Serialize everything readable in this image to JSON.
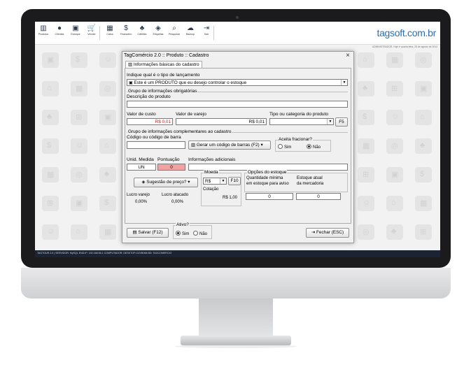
{
  "brand": "tagsoft.com.br",
  "admin_line": "ADMINISTRADOR, Hoje é quarta-feira, 28 de agosto de 2014",
  "toolbar": [
    {
      "icon": "barcode-icon",
      "glyph": "▥",
      "label": "Produtos"
    },
    {
      "icon": "user-icon",
      "glyph": "●",
      "label": "Clientes"
    },
    {
      "icon": "box-icon",
      "glyph": "▣",
      "label": "Estoque"
    },
    {
      "icon": "cart-icon",
      "glyph": "🛒",
      "label": "Vender"
    },
    {
      "icon": "cash-register-icon",
      "glyph": "▦",
      "label": "Caixa"
    },
    {
      "icon": "dollar-icon",
      "glyph": "$",
      "label": "Financeiro"
    },
    {
      "icon": "people-icon",
      "glyph": "♣",
      "label": "Cdbiltes"
    },
    {
      "icon": "tag-icon",
      "glyph": "◈",
      "label": "Etiquetas"
    },
    {
      "icon": "search-icon",
      "glyph": "⌕",
      "label": "Pesquisar"
    },
    {
      "icon": "cloud-icon",
      "glyph": "☁",
      "label": "Backup"
    },
    {
      "icon": "exit-icon",
      "glyph": "⇥",
      "label": "Sair"
    }
  ],
  "statusbar": "TAGTOUR 2.0 | SERVIDOR: MySQL    END.IP: 192.168.56.1    COMPUTADOR: DESKTOP-OZVB066    BD: TAGCOMERCIO",
  "dialog": {
    "title": "TagComércio 2.0 :: Produto :: Cadastro",
    "close": "×",
    "tab": "Informações básicas do cadastro",
    "tipo_label": "Indique qual é o tipo de lançamento",
    "tipo_value": "Este é um PRODUTO que eu desejo controlar o estoque",
    "grupo_obrig": "Grupo de informações obrigatórias",
    "descricao_label": "Descrição do produto",
    "descricao_value": "",
    "custo_label": "Valor de custo",
    "custo_value": "R$ 0,01",
    "varejo_label": "Valor de varejo",
    "varejo_value": "R$ 0,01",
    "categoria_label": "Tipo ou categoria do produto",
    "categoria_value": "",
    "f5": "F5",
    "grupo_compl": "Grupo de informações complementares ao cadastro",
    "codigo_label": "Código ou código de barra",
    "codigo_value": "",
    "gerar_btn": "Gerar um código de barras (F2)",
    "fracionar_label": "Aceita fracionar?",
    "fracionar_sim": "Sim",
    "fracionar_nao": "Não",
    "unid_label": "Unid. Medida",
    "unid_value": "UN",
    "pontuacao_label": "Pontuação",
    "pontuacao_value": "0",
    "info_label": "Informações adicionais",
    "info_value": "",
    "sugestao_btn": "Sugestão de preço?",
    "moeda_label": "Moeda",
    "moeda_value": "R$",
    "f10": "F10",
    "cotacao_label": "Cotação",
    "cotacao_value": "R$ 1,00",
    "lucro_varejo_label": "Lucro varejo",
    "lucro_varejo_value": "0,00%",
    "lucro_atacado_label": "Lucro atacado",
    "lucro_atacado_value": "0,00%",
    "estoque_group": "Opções do estoque",
    "qtd_min_label1": "Quantidade mínima",
    "qtd_min_label2": "em estoque para aviso",
    "qtd_min_value": "0",
    "estoque_atual_label1": "Estoque atual",
    "estoque_atual_label2": "da mercadoria",
    "estoque_atual_value": "0",
    "salvar_btn": "Salvar (F12)",
    "ativo_label": "Ativo?",
    "ativo_sim": "Sim",
    "ativo_nao": "Não",
    "fechar_btn": "Fechar (ESC)"
  }
}
